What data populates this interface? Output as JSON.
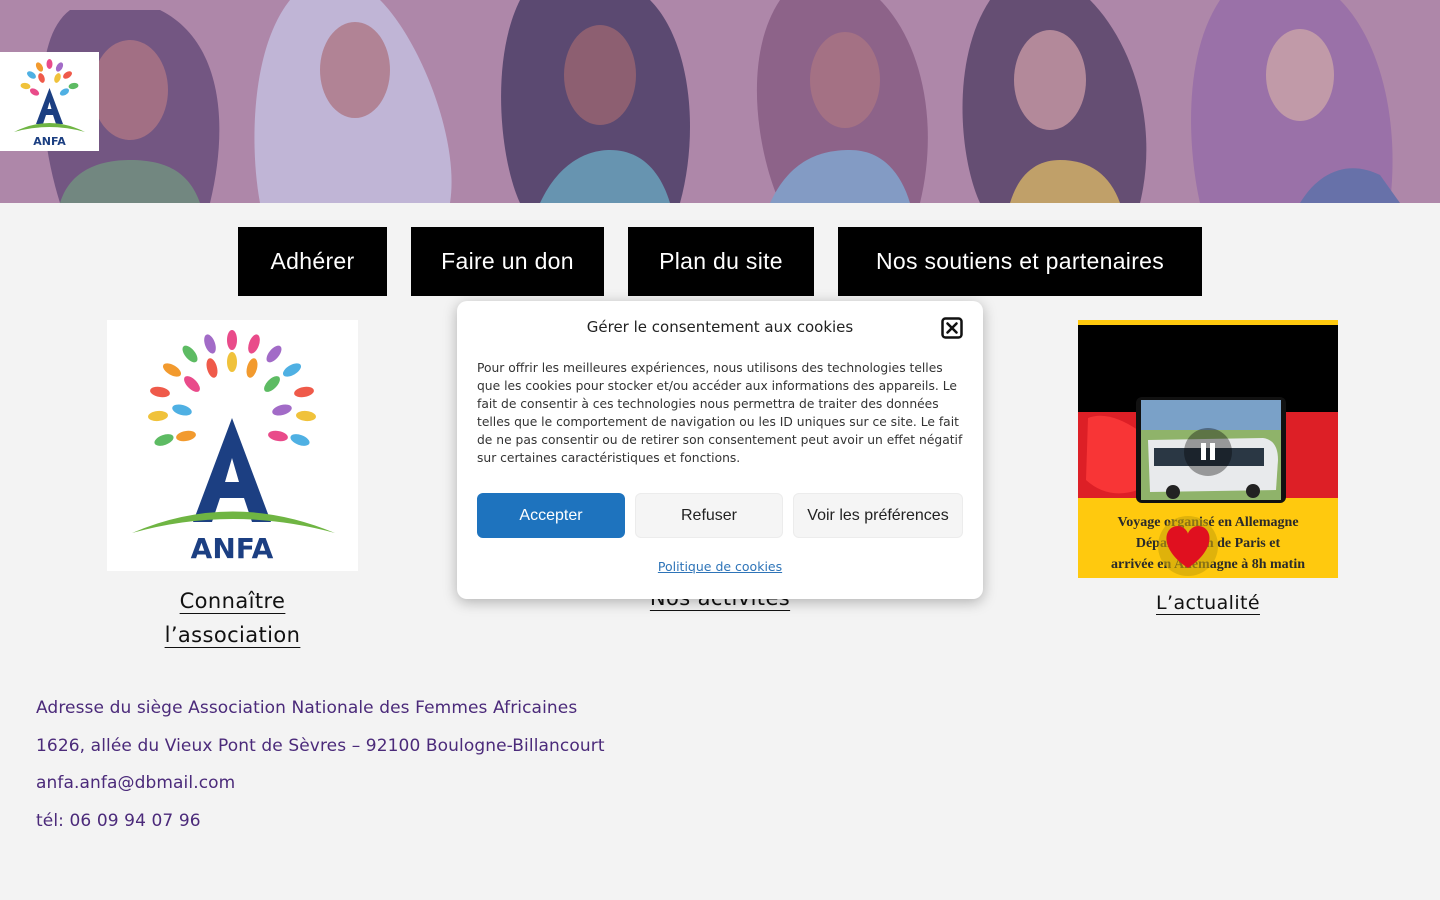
{
  "banner": {
    "logo_text": "ANFA"
  },
  "nav": {
    "buttons": [
      "Adhérer",
      "Faire un don",
      "Plan du site",
      "Nos soutiens et partenaires"
    ]
  },
  "cards": {
    "assoc": {
      "logo_text": "ANFA",
      "link_line1": "Connaître",
      "link_line2": "l’association"
    },
    "activites": {
      "link": "Nos activités"
    },
    "news": {
      "link": "L’actualité",
      "caption_line1": "Voyage organisé en Allemagne",
      "caption_line2": "Départ à 22h de Paris et",
      "caption_line3": "arrivée en Allemagne à 8h matin"
    }
  },
  "address": {
    "line1": "Adresse du siège Association Nationale des Femmes Africaines",
    "line2": "1626, allée du Vieux Pont de Sèvres – 92100 Boulogne-Billancourt",
    "email": "anfa.anfa@dbmail.com",
    "phone": "tél: 06 09 94 07 96"
  },
  "cookie": {
    "title": "Gérer le consentement aux cookies",
    "text": "Pour offrir les meilleures expériences, nous utilisons des technologies telles que les cookies pour stocker et/ou accéder aux informations des appareils. Le fait de consentir à ces technologies nous permettra de traiter des données telles que le comportement de navigation ou les ID uniques sur ce site. Le fait de ne pas consentir ou de retirer son consentement peut avoir un effet négatif sur certaines caractéristiques et fonctions.",
    "accept": "Accepter",
    "refuse": "Refuser",
    "preferences": "Voir les préférences",
    "policy": "Politique de cookies"
  },
  "colors": {
    "banner_bg": "#b38aa8",
    "nav_bg": "#000000",
    "accept_bg": "#1e73be",
    "address_text": "#4b2a7a",
    "link_blue": "#2e74b8"
  },
  "icons": [
    "close-icon",
    "pause-icon",
    "heart-icon",
    "leaf-tree-logo"
  ]
}
